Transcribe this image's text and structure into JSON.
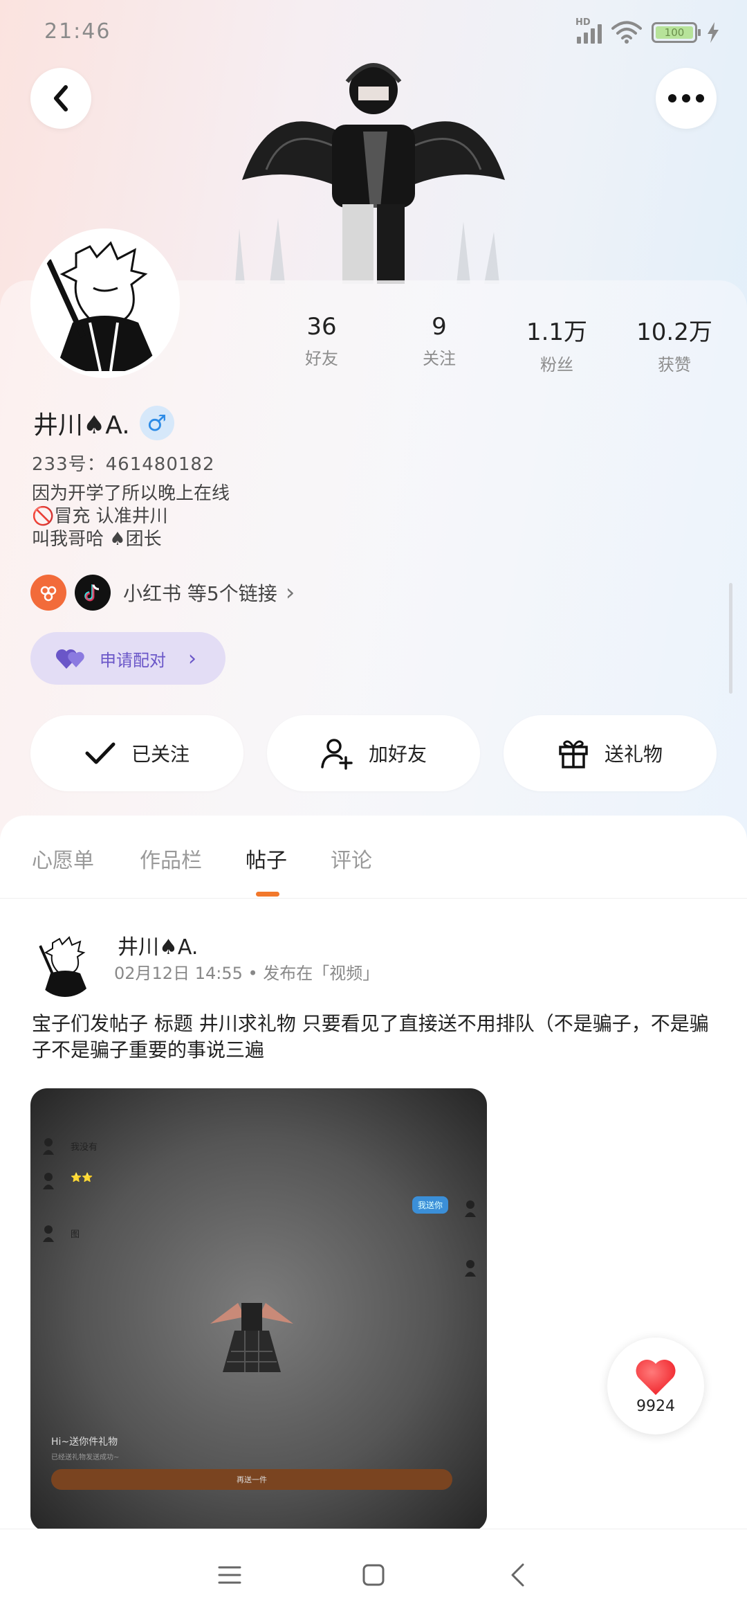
{
  "status_bar": {
    "time": "21:46",
    "network": "HD",
    "battery": "100"
  },
  "header": {
    "back_icon": "chevron-left-icon",
    "more_icon": "more-dots-icon"
  },
  "profile": {
    "username": "井川♠A.",
    "gender_symbol": "♂",
    "uid": "233号：461480182",
    "bio": [
      "因为开学了所以晚上在线",
      "🚫冒充 认准井川",
      "叫我哥哈 ♠团长"
    ],
    "stats": [
      {
        "value": "36",
        "label": "好友"
      },
      {
        "value": "9",
        "label": "关注"
      },
      {
        "value": "1.1万",
        "label": "粉丝"
      },
      {
        "value": "10.2万",
        "label": "获赞"
      }
    ],
    "links_text": "小红书 等5个链接",
    "match_button": "申请配对",
    "actions": {
      "follow": "已关注",
      "add_friend": "加好友",
      "gift": "送礼物"
    }
  },
  "tabs": [
    {
      "label": "心愿单",
      "active": false
    },
    {
      "label": "作品栏",
      "active": false
    },
    {
      "label": "帖子",
      "active": true
    },
    {
      "label": "评论",
      "active": false
    }
  ],
  "post": {
    "author": "井川♠A.",
    "meta": "02月12日 14:55 • 发布在「视频」",
    "text": "宝子们发帖子 标题 井川求礼物 只要看见了直接送不用排队（不是骗子，不是骗子不是骗子重要的事说三遍",
    "image": {
      "chat_lines": [
        "我没有",
        "⭐⭐",
        "图"
      ],
      "bubble": "我送你",
      "footer_title": "Hi~送你件礼物",
      "footer_sub": "已经送礼物发送成功~",
      "footer_button": "再送一件"
    }
  },
  "like": {
    "count": "9924"
  },
  "colors": {
    "accent": "#f2782b",
    "match": "#6a56c8",
    "gender": "#2d8be6"
  }
}
